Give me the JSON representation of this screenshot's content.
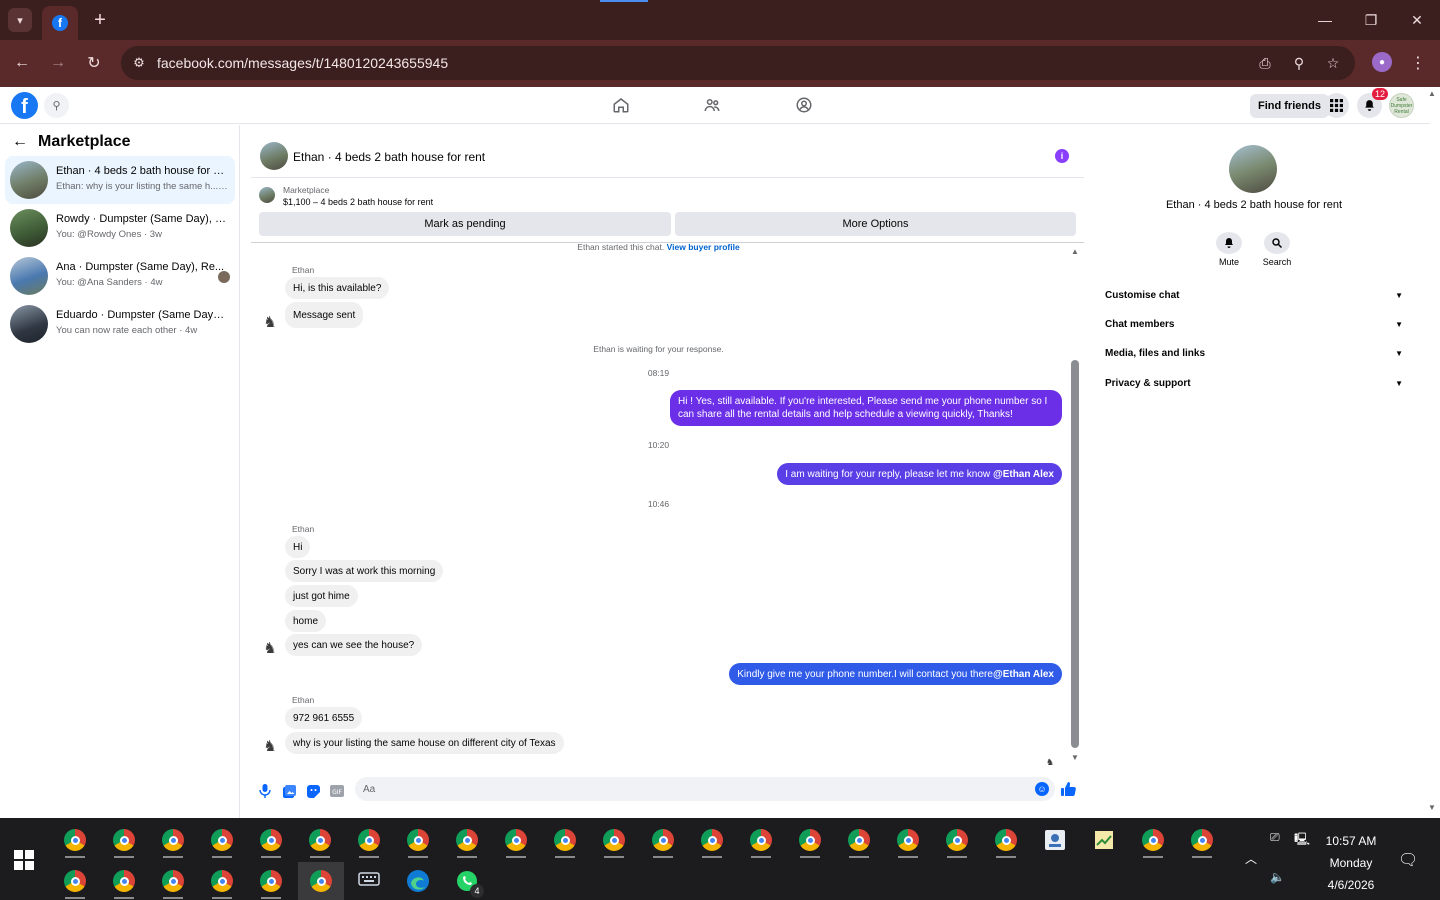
{
  "browser": {
    "url": "facebook.com/messages/t/1480120243655945",
    "new_tab_glyph": "+",
    "tab_favicon_letter": "f"
  },
  "fb_top": {
    "find_friends": "Find friends",
    "notification_count": "12",
    "account_avatar_text": "Safe Dumpster Rental"
  },
  "sidebar": {
    "title": "Marketplace",
    "chats": [
      {
        "name": "Ethan · 4 beds 2 bath house for rent",
        "preview": "Ethan: why is your listing the same h... · 7m",
        "active": true
      },
      {
        "name": "Rowdy · Dumpster (Same Day), Re...",
        "preview": "You: @Rowdy Ones · 3w",
        "active": false
      },
      {
        "name": "Ana · Dumpster (Same Day), Re...",
        "preview": "You: @Ana Sanders · 4w",
        "active": false
      },
      {
        "name": "Eduardo · Dumpster (Same Day), R...",
        "preview": "You can now rate each other · 4w",
        "active": false
      }
    ]
  },
  "conversation": {
    "title": "Ethan · 4 beds 2 bath house for rent",
    "marketplace_label": "Marketplace",
    "listing_price": "$1,100 – 4 beds 2 bath house for rent",
    "mark_pending": "Mark as pending",
    "more_options": "More Options",
    "started_text": "Ethan started this chat.",
    "view_buyer_profile": "View buyer profile",
    "waiting_note": "Ethan is waiting for your response.",
    "composer_placeholder": "Aa",
    "messages": {
      "sender_1": "Ethan",
      "in_1": "Hi, is this available?",
      "in_2": "Message sent",
      "time_1": "08:19",
      "out_1": "Hi ! Yes, still available. If you're interested, Please send me your phone number so I can share all the rental details and help schedule a viewing quickly, Thanks!",
      "time_2": "10:20",
      "out_2_text": "I am waiting for your reply, please let me know ",
      "out_2_mention": "@Ethan Alex",
      "time_3": "10:46",
      "sender_2": "Ethan",
      "in_3": "Hi",
      "in_4": "Sorry I was at work this morning",
      "in_5": "just got hime",
      "in_6": "home",
      "in_7": "yes can we see the house?",
      "out_3_text": "Kindly give me your phone number.I will contact you there ",
      "out_3_mention": "@Ethan Alex",
      "sender_3": "Ethan",
      "in_8": "972 961 6555",
      "in_9": "why is your listing the same house on different city of Texas"
    }
  },
  "info_panel": {
    "title": "Ethan · 4 beds 2 bath house for rent",
    "mute": "Mute",
    "search": "Search",
    "sections": [
      "Customise chat",
      "Chat members",
      "Media, files and links",
      "Privacy & support"
    ]
  },
  "taskbar": {
    "time": "10:57 AM",
    "day": "Monday",
    "date": "4/6/2026",
    "whatsapp_badge": "4"
  },
  "colors": {
    "chrome_titlebar": "#3b1e1e",
    "chrome_toolbar": "#5a2a2a",
    "fb_blue": "#1877f2",
    "bubble_purple": "#6b2fe8",
    "bubble_blue": "#2f5be8",
    "taskbar": "#1c1c1e"
  }
}
